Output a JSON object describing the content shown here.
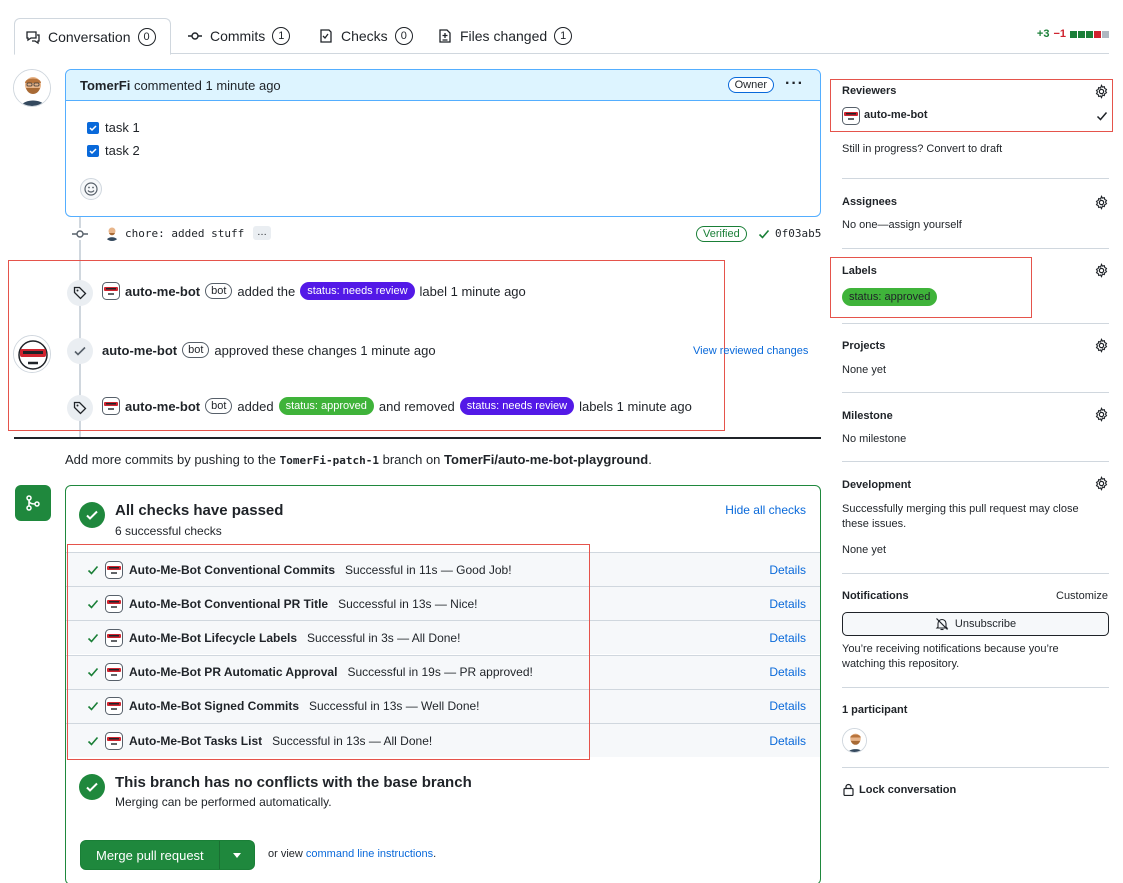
{
  "tabs": [
    {
      "label": "Conversation",
      "count": "0"
    },
    {
      "label": "Commits",
      "count": "1"
    },
    {
      "label": "Checks",
      "count": "0"
    },
    {
      "label": "Files changed",
      "count": "1"
    }
  ],
  "diffstat": {
    "additions": "+3",
    "deletions": "−1"
  },
  "comment": {
    "author": "TomerFi",
    "action": "commented 1 minute ago",
    "badge": "Owner",
    "tasks": [
      "task 1",
      "task 2"
    ]
  },
  "commit": {
    "message": "chore: added stuff",
    "more": "…",
    "verified": "Verified",
    "sha": "0f03ab5"
  },
  "events": {
    "bot_name": "auto-me-bot",
    "bot_badge": "bot",
    "e1_added": "added the",
    "e1_label": "status: needs review",
    "e1_tail": "label 1 minute ago",
    "e2_text": "approved these changes 1 minute ago",
    "e2_link": "View reviewed changes",
    "e3_added": "added",
    "e3_label_added": "status: approved",
    "e3_mid": "and removed",
    "e3_label_removed": "status: needs review",
    "e3_tail": "labels 1 minute ago"
  },
  "push_hint": {
    "pre": "Add more commits by pushing to the",
    "branch": "TomerFi-patch-1",
    "mid": "branch on",
    "repo": "TomerFi/auto-me-bot-playground",
    "end": "."
  },
  "checks": {
    "title": "All checks have passed",
    "subtitle": "6 successful checks",
    "hide": "Hide all checks",
    "details_label": "Details",
    "items": [
      {
        "name": "Auto-Me-Bot Conventional Commits",
        "desc": "Successful in 11s — Good Job!"
      },
      {
        "name": "Auto-Me-Bot Conventional PR Title",
        "desc": "Successful in 13s — Nice!"
      },
      {
        "name": "Auto-Me-Bot Lifecycle Labels",
        "desc": "Successful in 3s — All Done!"
      },
      {
        "name": "Auto-Me-Bot PR Automatic Approval",
        "desc": "Successful in 19s — PR approved!"
      },
      {
        "name": "Auto-Me-Bot Signed Commits",
        "desc": "Successful in 13s — Well Done!"
      },
      {
        "name": "Auto-Me-Bot Tasks List",
        "desc": "Successful in 13s — All Done!"
      }
    ],
    "conflict_title": "This branch has no conflicts with the base branch",
    "conflict_sub": "Merging can be performed automatically.",
    "merge_button": "Merge pull request",
    "or_view": "or view",
    "cli_link": "command line instructions",
    "cli_end": "."
  },
  "sidebar": {
    "reviewers_title": "Reviewers",
    "reviewer_name": "auto-me-bot",
    "draft_text": "Still in progress? Convert to draft",
    "assignees_title": "Assignees",
    "assignees_value": "No one—assign yourself",
    "labels_title": "Labels",
    "label_value": "status: approved",
    "projects_title": "Projects",
    "projects_value": "None yet",
    "milestone_title": "Milestone",
    "milestone_value": "No milestone",
    "development_title": "Development",
    "development_text": "Successfully merging this pull request may close these issues.",
    "development_value": "None yet",
    "notifications_title": "Notifications",
    "customize": "Customize",
    "unsubscribe": "Unsubscribe",
    "notif_text": "You’re receiving notifications because you’re watching this repository.",
    "participants": "1 participant",
    "lock": "Lock conversation"
  },
  "colors": {
    "accent": "#0969da",
    "success": "#1f883d",
    "needs_review": "#5319e7",
    "approved": "#3fb33a",
    "highlight": "#e5534b"
  }
}
